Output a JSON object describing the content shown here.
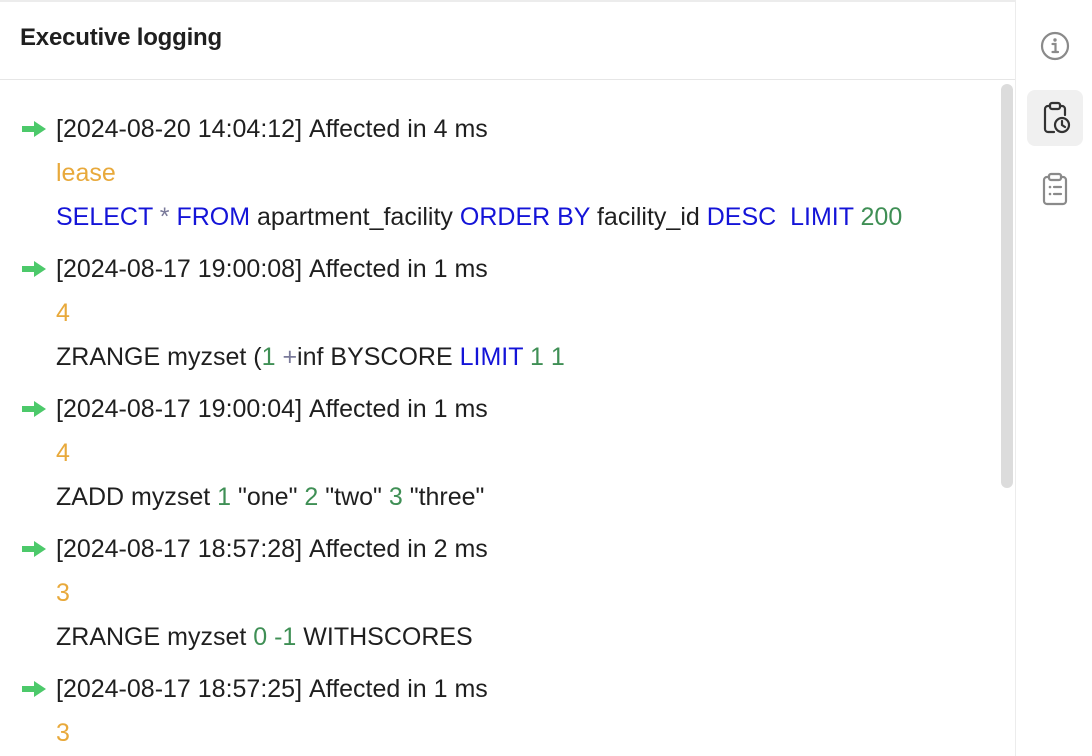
{
  "header": {
    "title": "Executive logging"
  },
  "sidebar": {
    "items": [
      {
        "icon": "info-icon",
        "active": false
      },
      {
        "icon": "clipboard-history-icon",
        "active": true
      },
      {
        "icon": "clipboard-list-icon",
        "active": false
      }
    ]
  },
  "colors": {
    "result": "#e8a93b",
    "keyword": "#1414d8",
    "number": "#3f8f55",
    "arrow": "#4cc96a"
  },
  "entries": [
    {
      "timestamp": "[2024-08-20 14:04:12]",
      "affected": "Affected in 4 ms",
      "result": "lease",
      "command": [
        {
          "t": "SELECT",
          "k": "kw"
        },
        {
          "t": " ",
          "k": "plain"
        },
        {
          "t": "*",
          "k": "op"
        },
        {
          "t": " ",
          "k": "plain"
        },
        {
          "t": "FROM",
          "k": "kw"
        },
        {
          "t": " apartment_facility ",
          "k": "plain"
        },
        {
          "t": "ORDER BY",
          "k": "kw"
        },
        {
          "t": " facility_id ",
          "k": "plain"
        },
        {
          "t": "DESC",
          "k": "kw"
        },
        {
          "t": "  ",
          "k": "plain"
        },
        {
          "t": "LIMIT",
          "k": "kw"
        },
        {
          "t": " ",
          "k": "plain"
        },
        {
          "t": "200",
          "k": "num"
        }
      ]
    },
    {
      "timestamp": "[2024-08-17 19:00:08]",
      "affected": "Affected in 1 ms",
      "result": "4",
      "command": [
        {
          "t": "ZRANGE myzset (",
          "k": "plain"
        },
        {
          "t": "1",
          "k": "num"
        },
        {
          "t": " ",
          "k": "plain"
        },
        {
          "t": "+",
          "k": "op"
        },
        {
          "t": "inf BYSCORE ",
          "k": "plain"
        },
        {
          "t": "LIMIT",
          "k": "kw"
        },
        {
          "t": " ",
          "k": "plain"
        },
        {
          "t": "1",
          "k": "num"
        },
        {
          "t": " ",
          "k": "plain"
        },
        {
          "t": "1",
          "k": "num"
        }
      ]
    },
    {
      "timestamp": "[2024-08-17 19:00:04]",
      "affected": "Affected in 1 ms",
      "result": "4",
      "command": [
        {
          "t": "ZADD myzset ",
          "k": "plain"
        },
        {
          "t": "1",
          "k": "num"
        },
        {
          "t": " \"one\" ",
          "k": "plain"
        },
        {
          "t": "2",
          "k": "num"
        },
        {
          "t": " \"two\" ",
          "k": "plain"
        },
        {
          "t": "3",
          "k": "num"
        },
        {
          "t": " \"three\"",
          "k": "plain"
        }
      ]
    },
    {
      "timestamp": "[2024-08-17 18:57:28]",
      "affected": "Affected in 2 ms",
      "result": "3",
      "command": [
        {
          "t": "ZRANGE myzset ",
          "k": "plain"
        },
        {
          "t": "0",
          "k": "num"
        },
        {
          "t": " ",
          "k": "plain"
        },
        {
          "t": "-1",
          "k": "num"
        },
        {
          "t": " WITHSCORES",
          "k": "plain"
        }
      ]
    },
    {
      "timestamp": "[2024-08-17 18:57:25]",
      "affected": "Affected in 1 ms",
      "result": "3",
      "command": []
    }
  ]
}
